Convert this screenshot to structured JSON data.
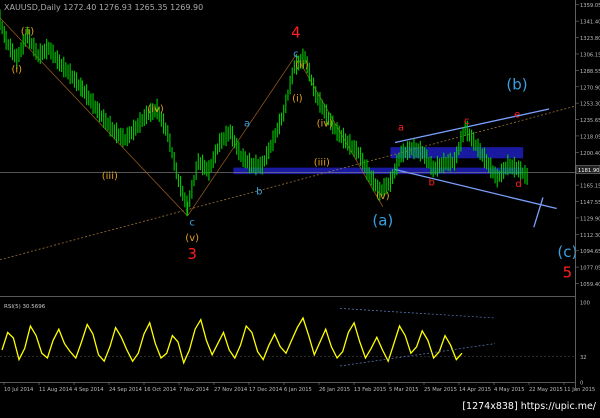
{
  "header": {
    "text": "XAUUSD,Daily 1272.40 1276.93 1265.35 1269.90"
  },
  "watermark": "[1274x838] https://upic.me/",
  "colors": {
    "bull": "#00cc00",
    "bear": "#00cc00",
    "rsi_line": "#ffff00",
    "band": "#1a1aa0",
    "wave_orange": "#e0a020",
    "wave_blue": "#39a0e0",
    "wave_red": "#ff2020",
    "channel": "#7aa0ff"
  },
  "chart_data": [
    {
      "type": "line",
      "title": "XAUUSD Daily",
      "ylim": [
        1046.0,
        1362.0
      ],
      "y_ticks": [
        "1359.05",
        "1341.40",
        "1323.80",
        "1306.15",
        "1288.55",
        "1270.90",
        "1253.30",
        "1235.65",
        "1218.05",
        "1200.40",
        "1182.80",
        "1165.15",
        "1147.55",
        "1129.90",
        "1112.30",
        "1094.65",
        "1077.05",
        "1059.40"
      ],
      "x_ticks": [
        "10 Jul 2014",
        "11 Aug 2014",
        "4 Sep 2014",
        "24 Sep 2014",
        "16 Oct 2014",
        "7 Nov 2014",
        "27 Nov 2014",
        "17 Dec 2014",
        "6 Jan 2015",
        "26 Jan 2015",
        "13 Feb 2015",
        "5 Mar 2015",
        "25 Mar 2015",
        "14 Apr 2015",
        "4 May 2015",
        "22 May 2015",
        "11 Jun 2015"
      ],
      "current_price": "1181.90",
      "wave_labels": [
        {
          "text": "(ii)",
          "x": "2014-07-28",
          "y": 1327,
          "color": "orange"
        },
        {
          "text": "(i)",
          "x": "2014-07-21",
          "y": 1286,
          "color": "orange"
        },
        {
          "text": "(iv)",
          "x": "2014-10-20",
          "y": 1244,
          "color": "orange"
        },
        {
          "text": "(iii)",
          "x": "2014-09-20",
          "y": 1172,
          "color": "orange"
        },
        {
          "text": "(v)",
          "x": "2014-11-13",
          "y": 1105,
          "color": "orange"
        },
        {
          "text": "c",
          "x": "2014-11-13",
          "y": 1122,
          "color": "blue"
        },
        {
          "text": "3",
          "x": "2014-11-13",
          "y": 1086,
          "color": "red"
        },
        {
          "text": "a",
          "x": "2014-12-19",
          "y": 1228,
          "color": "blue"
        },
        {
          "text": "b",
          "x": "2014-12-27",
          "y": 1155,
          "color": "blue"
        },
        {
          "text": "c",
          "x": "2015-01-20",
          "y": 1303,
          "color": "blue"
        },
        {
          "text": "4",
          "x": "2015-01-20",
          "y": 1324,
          "color": "red"
        },
        {
          "text": "(ii)",
          "x": "2015-01-24",
          "y": 1291,
          "color": "orange"
        },
        {
          "text": "(i)",
          "x": "2015-01-21",
          "y": 1255,
          "color": "orange"
        },
        {
          "text": "(iv)",
          "x": "2015-02-08",
          "y": 1228,
          "color": "orange"
        },
        {
          "text": "(iii)",
          "x": "2015-02-06",
          "y": 1186,
          "color": "orange"
        },
        {
          "text": "(v)",
          "x": "2015-03-18",
          "y": 1150,
          "color": "orange"
        },
        {
          "text": "(a)",
          "x": "2015-03-18",
          "y": 1122,
          "color": "blue"
        },
        {
          "text": "a",
          "x": "2015-03-30",
          "y": 1224,
          "color": "red"
        },
        {
          "text": "b",
          "x": "2015-04-19",
          "y": 1165,
          "color": "red"
        },
        {
          "text": "c",
          "x": "2015-05-12",
          "y": 1231,
          "color": "red"
        },
        {
          "text": "e",
          "x": "2015-06-14",
          "y": 1238,
          "color": "red"
        },
        {
          "text": "d",
          "x": "2015-06-15",
          "y": 1163,
          "color": "red"
        },
        {
          "text": "(b)",
          "x": "2015-06-14",
          "y": 1268,
          "color": "blue"
        },
        {
          "text": "(c)",
          "x": "2015-07-17",
          "y": 1088,
          "color": "blue"
        },
        {
          "text": "5",
          "x": "2015-07-17",
          "y": 1066,
          "color": "red"
        }
      ],
      "bands": [
        {
          "y_low": 1194,
          "y_high": 1206
        },
        {
          "y_low": 1177,
          "y_high": 1184
        }
      ],
      "series": [
        {
          "name": "close",
          "x": [
            "2014-07-10",
            "2014-07-14",
            "2014-07-21",
            "2014-07-28",
            "2014-08-04",
            "2014-08-11",
            "2014-08-18",
            "2014-08-25",
            "2014-09-02",
            "2014-09-09",
            "2014-09-16",
            "2014-09-23",
            "2014-09-30",
            "2014-10-07",
            "2014-10-14",
            "2014-10-21",
            "2014-10-28",
            "2014-11-04",
            "2014-11-10",
            "2014-11-17",
            "2014-11-24",
            "2014-12-01",
            "2014-12-08",
            "2014-12-15",
            "2014-12-22",
            "2014-12-29",
            "2015-01-05",
            "2015-01-12",
            "2015-01-19",
            "2015-01-26",
            "2015-02-02",
            "2015-02-09",
            "2015-02-16",
            "2015-02-23",
            "2015-03-02",
            "2015-03-09",
            "2015-03-16",
            "2015-03-23",
            "2015-03-30",
            "2015-04-06",
            "2015-04-13",
            "2015-04-20",
            "2015-04-27",
            "2015-05-04",
            "2015-05-11",
            "2015-05-18",
            "2015-05-25",
            "2015-06-01",
            "2015-06-08",
            "2015-06-15",
            "2015-06-22"
          ],
          "values": [
            1342,
            1320,
            1300,
            1326,
            1304,
            1312,
            1296,
            1284,
            1268,
            1252,
            1236,
            1222,
            1214,
            1226,
            1240,
            1246,
            1220,
            1170,
            1140,
            1190,
            1180,
            1210,
            1222,
            1196,
            1186,
            1186,
            1212,
            1242,
            1292,
            1302,
            1262,
            1240,
            1222,
            1210,
            1200,
            1176,
            1158,
            1168,
            1198,
            1204,
            1200,
            1182,
            1188,
            1190,
            1226,
            1208,
            1190,
            1172,
            1186,
            1182,
            1172
          ]
        }
      ]
    },
    {
      "type": "line",
      "title": "RSI(5) 30.5696",
      "ylim": [
        0,
        100
      ],
      "y_ticks": [
        "100",
        "32",
        "0"
      ],
      "series": [
        {
          "name": "RSI(5)",
          "values": [
            40,
            62,
            55,
            28,
            42,
            70,
            58,
            36,
            30,
            52,
            66,
            48,
            38,
            30,
            50,
            72,
            60,
            34,
            26,
            44,
            68,
            56,
            40,
            26,
            36,
            60,
            74,
            48,
            30,
            36,
            58,
            50,
            24,
            40,
            66,
            78,
            52,
            34,
            48,
            62,
            40,
            30,
            46,
            70,
            62,
            38,
            28,
            46,
            60,
            44,
            36,
            52,
            68,
            80,
            58,
            34,
            50,
            66,
            44,
            30,
            38,
            62,
            74,
            50,
            30,
            42,
            56,
            40,
            26,
            48,
            70,
            58,
            36,
            44,
            64,
            52,
            30,
            38,
            58,
            46,
            28,
            36
          ]
        }
      ]
    }
  ]
}
